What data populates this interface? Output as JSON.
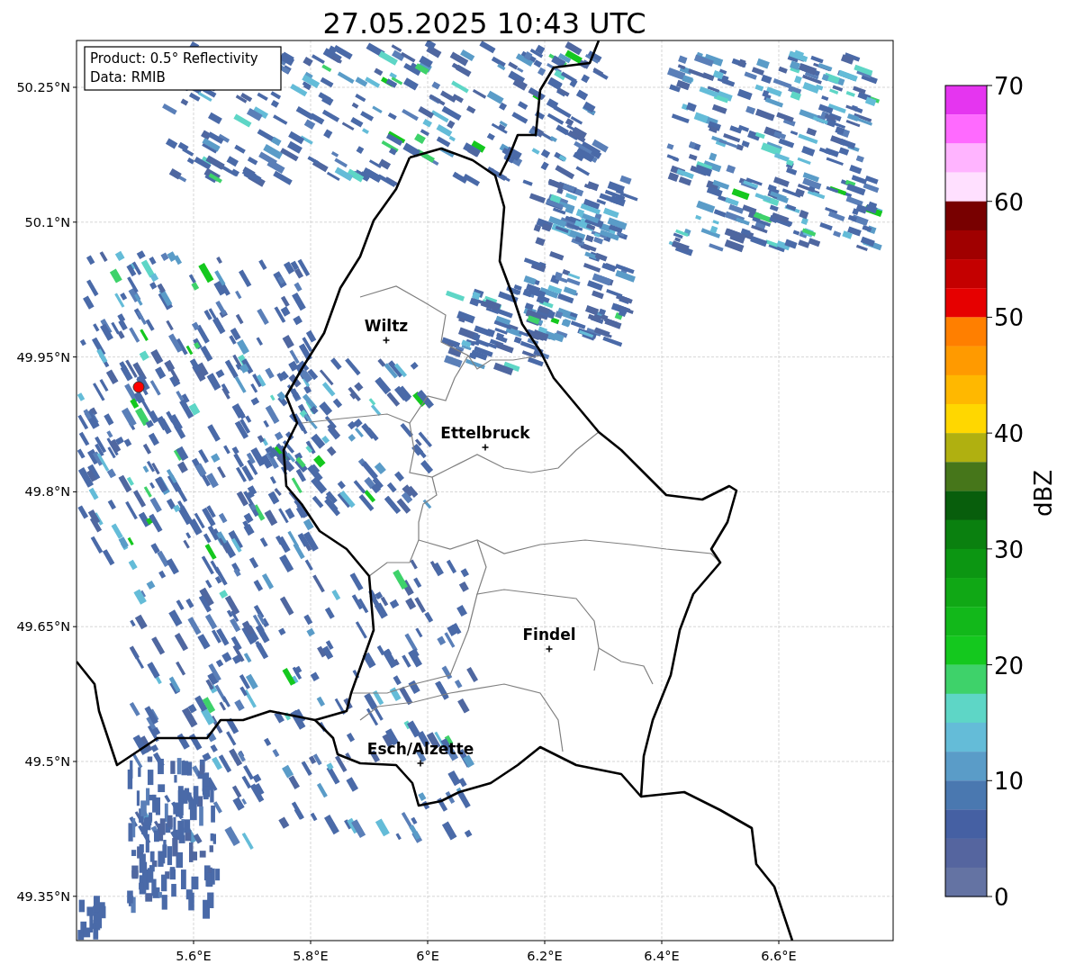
{
  "title": "27.05.2025 10:43 UTC",
  "info_box": {
    "lines": [
      "Product: 0.5° Reflectivity",
      "Data: RMIB"
    ]
  },
  "map": {
    "x_tick_labels": [
      "5.6°E",
      "5.8°E",
      "6°E",
      "6.2°E",
      "6.4°E",
      "6.6°E"
    ],
    "y_tick_labels": [
      "50.25°N",
      "50.1°N",
      "49.95°N",
      "49.8°N",
      "49.65°N",
      "49.5°N",
      "49.35°N"
    ],
    "cities": [
      {
        "name": "Wiltz"
      },
      {
        "name": "Ettelbruck"
      },
      {
        "name": "Findel"
      },
      {
        "name": "Esch/Alzette"
      }
    ]
  },
  "colorbar": {
    "label": "dBZ",
    "ticks": [
      "70",
      "60",
      "50",
      "40",
      "30",
      "20",
      "10",
      "0"
    ],
    "bins": [
      {
        "color": "#e535f0"
      },
      {
        "color": "#ff6aff"
      },
      {
        "color": "#ffb4ff"
      },
      {
        "color": "#ffe0ff"
      },
      {
        "color": "#780000"
      },
      {
        "color": "#a00000"
      },
      {
        "color": "#c40000"
      },
      {
        "color": "#e60000"
      },
      {
        "color": "#ff7f00"
      },
      {
        "color": "#ff9a00"
      },
      {
        "color": "#ffb800"
      },
      {
        "color": "#ffd700"
      },
      {
        "color": "#b0b010"
      },
      {
        "color": "#46761a"
      },
      {
        "color": "#085e0c"
      },
      {
        "color": "#0a800f"
      },
      {
        "color": "#0c9612"
      },
      {
        "color": "#10a815"
      },
      {
        "color": "#12b81a"
      },
      {
        "color": "#14c81e"
      },
      {
        "color": "#3ed26a"
      },
      {
        "color": "#5ed6c6"
      },
      {
        "color": "#64bcd8"
      },
      {
        "color": "#5a9cc8"
      },
      {
        "color": "#4a78b0"
      },
      {
        "color": "#4560a3"
      },
      {
        "color": "#55659f"
      },
      {
        "color": "#6473a3"
      }
    ]
  }
}
